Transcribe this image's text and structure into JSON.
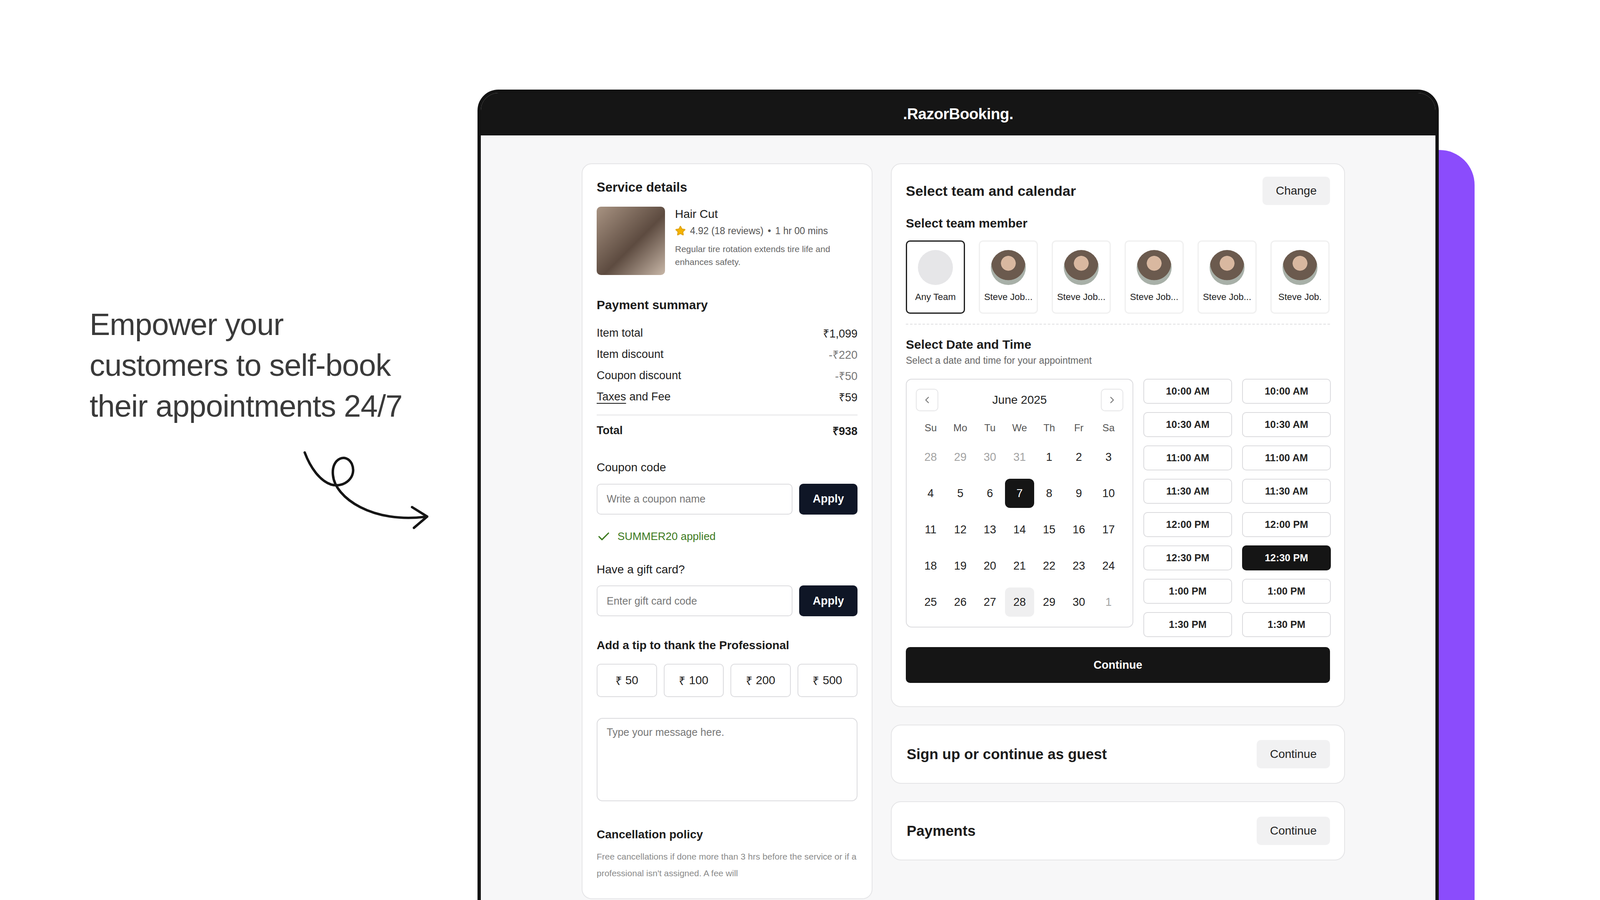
{
  "hero": {
    "lines": [
      "Empower your",
      "customers to self-book",
      "their appointments 24/7"
    ]
  },
  "app": {
    "title": ".RazorBooking."
  },
  "service": {
    "heading": "Service details",
    "name": "Hair Cut",
    "stars": 1,
    "rating": "4.92 (18 reviews)",
    "separator": "•",
    "duration": "1 hr 00 mins",
    "description": "Regular tire rotation extends tire life and enhances safety."
  },
  "payment": {
    "heading": "Payment summary",
    "rows": [
      {
        "label": "Item total",
        "underlined": "",
        "value": "₹1,099",
        "kind": "plain"
      },
      {
        "label": "Item discount",
        "underlined": "",
        "value": "-₹220",
        "kind": "discount"
      },
      {
        "label": "Coupon discount",
        "underlined": "",
        "value": "-₹50",
        "kind": "discount"
      },
      {
        "label": "and Fee",
        "underlined": "Taxes",
        "value": "₹59",
        "kind": "plain"
      }
    ],
    "total": {
      "label": "Total",
      "value": "₹938"
    }
  },
  "coupon": {
    "label": "Coupon code",
    "placeholder": "Write a coupon name",
    "button": "Apply",
    "applied": "SUMMER20 applied"
  },
  "gift_card": {
    "label": "Have a gift card?",
    "placeholder": "Enter gift card code",
    "button": "Apply"
  },
  "tip": {
    "heading": "Add a tip to thank the Professional",
    "options": [
      {
        "currency": "₹",
        "amount": "50",
        "selected": false
      },
      {
        "currency": "₹",
        "amount": "100",
        "selected": false
      },
      {
        "currency": "₹",
        "amount": "200",
        "selected": false
      },
      {
        "currency": "₹",
        "amount": "500",
        "selected": false
      }
    ],
    "message_placeholder": "Type your message here."
  },
  "cancellation": {
    "heading": "Cancellation policy",
    "text": "Free cancellations if done more than 3 hrs before the service or if a professional isn't  assigned. A fee will"
  },
  "schedule": {
    "heading": "Select team and calendar",
    "change_button": "Change",
    "team_heading": "Select team member",
    "members": [
      {
        "name": "Any Team",
        "kind": "any",
        "selected": true
      },
      {
        "name": "Steve Job...",
        "kind": "person",
        "selected": false
      },
      {
        "name": "Steve Job...",
        "kind": "person",
        "selected": false
      },
      {
        "name": "Steve Job...",
        "kind": "person",
        "selected": false
      },
      {
        "name": "Steve Job...",
        "kind": "person",
        "selected": false
      },
      {
        "name": "Steve Job.",
        "kind": "person",
        "selected": false
      }
    ],
    "date_heading": "Select Date and Time",
    "date_subtitle": "Select a date and time for your appointment",
    "calendar": {
      "month": "June 2025",
      "weekdays": [
        "Su",
        "Mo",
        "Tu",
        "We",
        "Th",
        "Fr",
        "Sa"
      ],
      "days": [
        {
          "label": "28",
          "outside": true,
          "selected": false,
          "today": false
        },
        {
          "label": "29",
          "outside": true,
          "selected": false,
          "today": false
        },
        {
          "label": "30",
          "outside": true,
          "selected": false,
          "today": false
        },
        {
          "label": "31",
          "outside": true,
          "selected": false,
          "today": false
        },
        {
          "label": "1",
          "outside": false,
          "selected": false,
          "today": false
        },
        {
          "label": "2",
          "outside": false,
          "selected": false,
          "today": false
        },
        {
          "label": "3",
          "outside": false,
          "selected": false,
          "today": false
        },
        {
          "label": "4",
          "outside": false,
          "selected": false,
          "today": false
        },
        {
          "label": "5",
          "outside": false,
          "selected": false,
          "today": false
        },
        {
          "label": "6",
          "outside": false,
          "selected": false,
          "today": false
        },
        {
          "label": "7",
          "outside": false,
          "selected": true,
          "today": false
        },
        {
          "label": "8",
          "outside": false,
          "selected": false,
          "today": false
        },
        {
          "label": "9",
          "outside": false,
          "selected": false,
          "today": false
        },
        {
          "label": "10",
          "outside": false,
          "selected": false,
          "today": false
        },
        {
          "label": "11",
          "outside": false,
          "selected": false,
          "today": false
        },
        {
          "label": "12",
          "outside": false,
          "selected": false,
          "today": false
        },
        {
          "label": "13",
          "outside": false,
          "selected": false,
          "today": false
        },
        {
          "label": "14",
          "outside": false,
          "selected": false,
          "today": false
        },
        {
          "label": "15",
          "outside": false,
          "selected": false,
          "today": false
        },
        {
          "label": "16",
          "outside": false,
          "selected": false,
          "today": false
        },
        {
          "label": "17",
          "outside": false,
          "selected": false,
          "today": false
        },
        {
          "label": "18",
          "outside": false,
          "selected": false,
          "today": false
        },
        {
          "label": "19",
          "outside": false,
          "selected": false,
          "today": false
        },
        {
          "label": "20",
          "outside": false,
          "selected": false,
          "today": false
        },
        {
          "label": "21",
          "outside": false,
          "selected": false,
          "today": false
        },
        {
          "label": "22",
          "outside": false,
          "selected": false,
          "today": false
        },
        {
          "label": "23",
          "outside": false,
          "selected": false,
          "today": false
        },
        {
          "label": "24",
          "outside": false,
          "selected": false,
          "today": false
        },
        {
          "label": "25",
          "outside": false,
          "selected": false,
          "today": false
        },
        {
          "label": "26",
          "outside": false,
          "selected": false,
          "today": false
        },
        {
          "label": "27",
          "outside": false,
          "selected": false,
          "today": false
        },
        {
          "label": "28",
          "outside": false,
          "selected": false,
          "today": true
        },
        {
          "label": "29",
          "outside": false,
          "selected": false,
          "today": false
        },
        {
          "label": "30",
          "outside": false,
          "selected": false,
          "today": false
        },
        {
          "label": "1",
          "outside": true,
          "selected": false,
          "today": false
        }
      ]
    },
    "times": [
      [
        {
          "label": "10:00 AM",
          "selected": false
        },
        {
          "label": "10:30 AM",
          "selected": false
        },
        {
          "label": "11:00 AM",
          "selected": false
        },
        {
          "label": "11:30 AM",
          "selected": false
        },
        {
          "label": "12:00 PM",
          "selected": false
        },
        {
          "label": "12:30 PM",
          "selected": false
        },
        {
          "label": "1:00 PM",
          "selected": false
        },
        {
          "label": "1:30 PM",
          "selected": false
        }
      ],
      [
        {
          "label": "10:00 AM",
          "selected": false
        },
        {
          "label": "10:30 AM",
          "selected": false
        },
        {
          "label": "11:00 AM",
          "selected": false
        },
        {
          "label": "11:30 AM",
          "selected": false
        },
        {
          "label": "12:00 PM",
          "selected": false
        },
        {
          "label": "12:30 PM",
          "selected": true
        },
        {
          "label": "1:00 PM",
          "selected": false
        },
        {
          "label": "1:30 PM",
          "selected": false
        }
      ]
    ],
    "continue": "Continue"
  },
  "steps": [
    {
      "title": "Sign up or continue as guest",
      "button": "Continue"
    },
    {
      "title": "Payments",
      "button": "Continue"
    }
  ]
}
